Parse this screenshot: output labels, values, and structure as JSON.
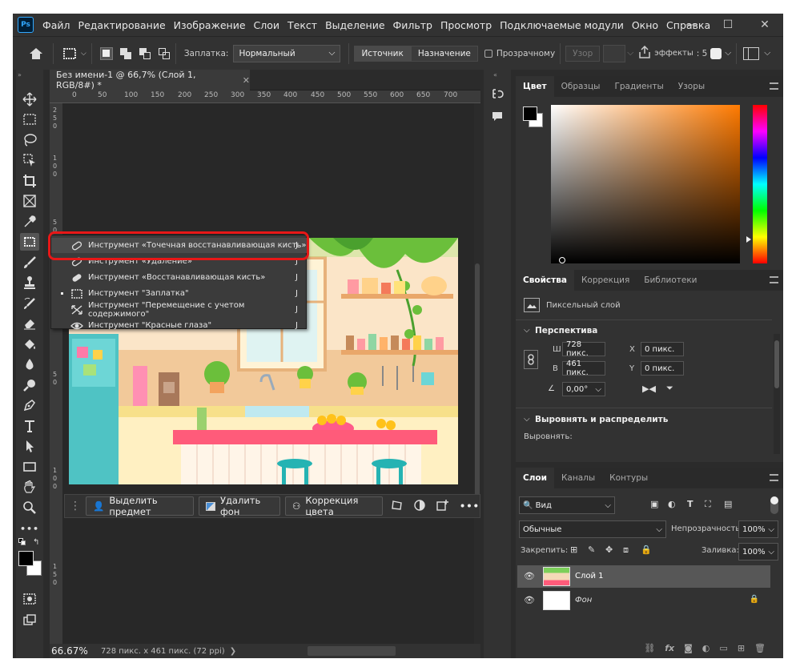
{
  "app": {
    "logo": "Ps"
  },
  "menu": [
    "Файл",
    "Редактирование",
    "Изображение",
    "Слои",
    "Текст",
    "Выделение",
    "Фильтр",
    "Просмотр",
    "Подключаемые модули",
    "Окно",
    "Справка"
  ],
  "options": {
    "patch_label": "Заплатка:",
    "patch_mode": "Нормальный",
    "source": "Источник",
    "destination": "Назначение",
    "transparent": "Прозрачному",
    "pattern": "Узор",
    "effects": "эффекты"
  },
  "document": {
    "tab_title": "Без имени-1 @ 66,7% (Слой 1, RGB/8#) *",
    "zoom": "66.67%",
    "doc_info": "728 пикс. x 461 пикс. (72 ppi)"
  },
  "ruler_top": [
    "0",
    "50",
    "100",
    "150",
    "200",
    "250",
    "300",
    "350",
    "400",
    "450",
    "500",
    "550",
    "600",
    "650",
    "700"
  ],
  "ruler_left": [
    "0",
    "5",
    "0",
    "1",
    "0",
    "0",
    "1",
    "5",
    "0",
    "2",
    "0",
    "0",
    "2",
    "5",
    "0",
    "3",
    "0",
    "0",
    "3",
    "5",
    "0",
    "4",
    "0",
    "0",
    "4",
    "5",
    "0"
  ],
  "flyout": [
    {
      "label": "Инструмент «Точечная восстанавливающая кисть»",
      "key": "J",
      "icon": "spot-healing-brush-icon",
      "active": true
    },
    {
      "label": "Инструмент «Удаление»",
      "key": "J",
      "icon": "remove-tool-icon",
      "active": false
    },
    {
      "label": "Инструмент «Восстанавливающая кисть»",
      "key": "J",
      "icon": "healing-brush-icon",
      "active": false
    },
    {
      "label": "Инструмент \"Заплатка\"",
      "key": "J",
      "icon": "patch-icon",
      "active": false
    },
    {
      "label": "Инструмент \"Перемещение с учетом содержимого\"",
      "key": "J",
      "icon": "content-aware-move-icon",
      "active": false
    },
    {
      "label": "Инструмент \"Красные глаза\"",
      "key": "J",
      "icon": "red-eye-icon",
      "active": false
    }
  ],
  "context_bar": {
    "select_subject": "Выделить предмет",
    "remove_bg": "Удалить фон",
    "color_correction": "Коррекция цвета"
  },
  "color_panel": {
    "tabs": [
      "Цвет",
      "Образцы",
      "Градиенты",
      "Узоры"
    ],
    "hue": "#ff7a00"
  },
  "properties": {
    "tabs": [
      "Свойства",
      "Коррекция",
      "Библиотеки"
    ],
    "layer_type": "Пиксельный слой",
    "section_perspective": "Перспектива",
    "w_label": "Ш",
    "w": "728 пикс.",
    "h_label": "В",
    "h": "461 пикс.",
    "x_label": "X",
    "x": "0 пикс.",
    "y_label": "Y",
    "y": "0 пикс.",
    "angle": "0,00°",
    "section_align": "Выровнять и распределить",
    "align_label": "Выровнять:"
  },
  "layers": {
    "tabs": [
      "Слои",
      "Каналы",
      "Контуры"
    ],
    "filter": "Вид",
    "blend": "Обычные",
    "opacity_label": "Непрозрачность:",
    "opacity": "100%",
    "lock_label": "Закрепить:",
    "fill_label": "Заливка:",
    "fill": "100%",
    "items": [
      {
        "name": "Слой 1",
        "selected": true
      },
      {
        "name": "Фон",
        "selected": false
      }
    ]
  }
}
